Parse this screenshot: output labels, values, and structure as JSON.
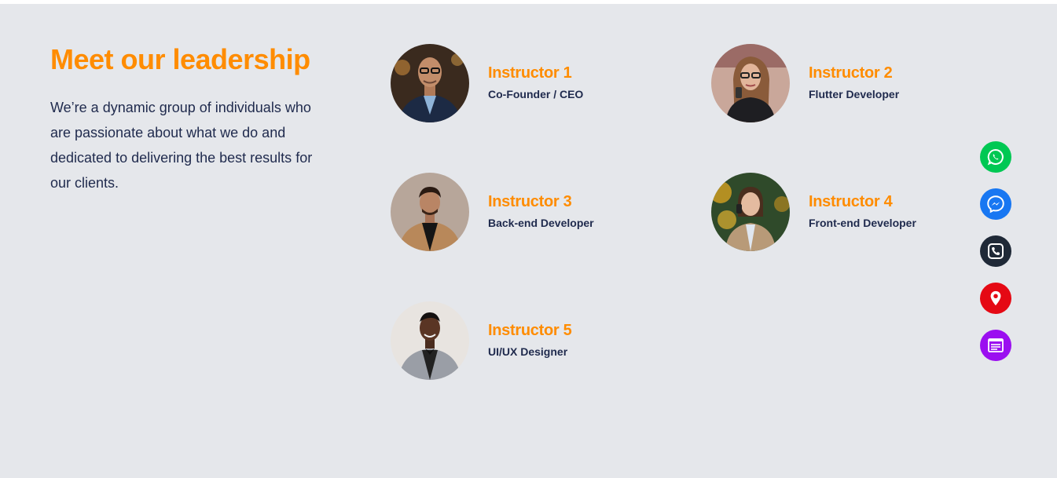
{
  "section": {
    "title": "Meet our leadership",
    "description": "We’re a dynamic group of individuals who are passionate about what we do and dedicated to delivering the best results for our clients."
  },
  "members": [
    {
      "name": "Instructor 1",
      "role": "Co-Founder / CEO"
    },
    {
      "name": "Instructor 2",
      "role": "Flutter Developer"
    },
    {
      "name": "Instructor 3",
      "role": "Back-end Developer"
    },
    {
      "name": "Instructor 4",
      "role": "Front-end Developer"
    },
    {
      "name": "Instructor 5",
      "role": "UI/UX Designer"
    }
  ],
  "floating_buttons": [
    {
      "icon": "whatsapp-icon",
      "color": "#00c853"
    },
    {
      "icon": "messenger-icon",
      "color": "#1877f2"
    },
    {
      "icon": "phone-icon",
      "color": "#1f2937"
    },
    {
      "icon": "location-pin-icon",
      "color": "#e50914"
    },
    {
      "icon": "form-icon",
      "color": "#9b0ff0"
    }
  ],
  "colors": {
    "accent": "#ff8c00",
    "text": "#1f2a4d",
    "background": "#e5e7eb"
  }
}
